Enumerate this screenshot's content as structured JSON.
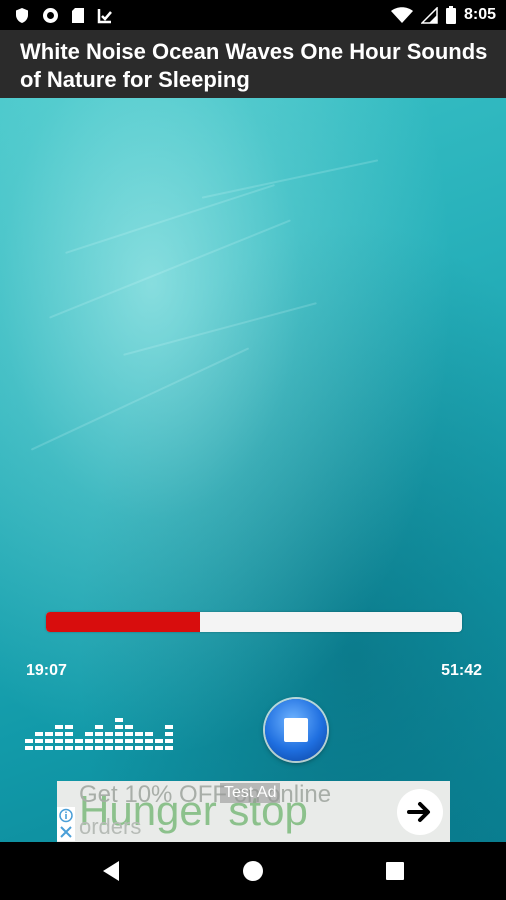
{
  "status_bar": {
    "time": "8:05",
    "left_icons": [
      "shield-icon",
      "circle-record-icon",
      "sd-card-icon",
      "check-download-icon"
    ],
    "right_icons": [
      "wifi-icon",
      "signal-icon",
      "battery-icon"
    ]
  },
  "header": {
    "title": "White Noise Ocean Waves One Hour Sounds of Nature for Sleeping"
  },
  "player": {
    "elapsed": "19:07",
    "duration": "51:42",
    "progress_fraction": 0.37,
    "progress_color": "#d80d0d",
    "equalizer_levels": [
      2,
      3,
      3,
      4,
      4,
      2,
      3,
      4,
      3,
      5,
      4,
      3,
      3,
      2,
      4
    ]
  },
  "ad": {
    "label": "Test Ad",
    "headline": "Get 10% OFF on online",
    "brand": "Hunger stop",
    "sub": "orders",
    "accent": "#8cc18c"
  },
  "colors": {
    "background_start": "#3cc3c7",
    "background_end": "#0a8496",
    "title_bar": "#2b2b2b",
    "stop_button": "#1f6fe0"
  }
}
